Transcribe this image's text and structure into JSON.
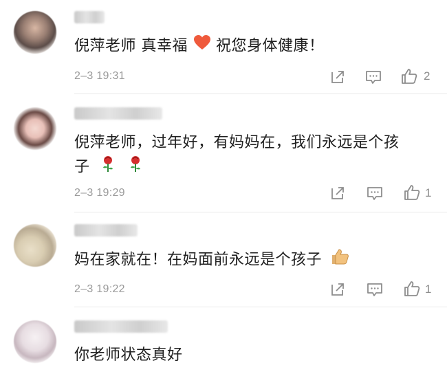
{
  "comments": [
    {
      "text_parts": [
        "倪萍老师 真幸福 ",
        " 祝您身体健康！"
      ],
      "inline_icon": "heart-emoji",
      "time": "2–3 19:31",
      "likes": "2"
    },
    {
      "text_line1": "倪萍老师，过年好，有妈妈在，我们永远是个孩",
      "text_line2": "子",
      "inline_icons": [
        "rose-emoji",
        "rose-emoji"
      ],
      "time": "2–3 19:29",
      "likes": "1"
    },
    {
      "text": "妈在家就在！在妈面前永远是个孩子",
      "inline_icon": "thumbs-up-emoji",
      "time": "2–3 19:22",
      "likes": "1"
    },
    {
      "text": "你老师状态真好"
    }
  ],
  "colors": {
    "text": "#1f1f1f",
    "meta": "#9a9a9a",
    "icon": "#8d8d8d",
    "heart": "#ef5a3c",
    "rose": "#d62f2f"
  }
}
